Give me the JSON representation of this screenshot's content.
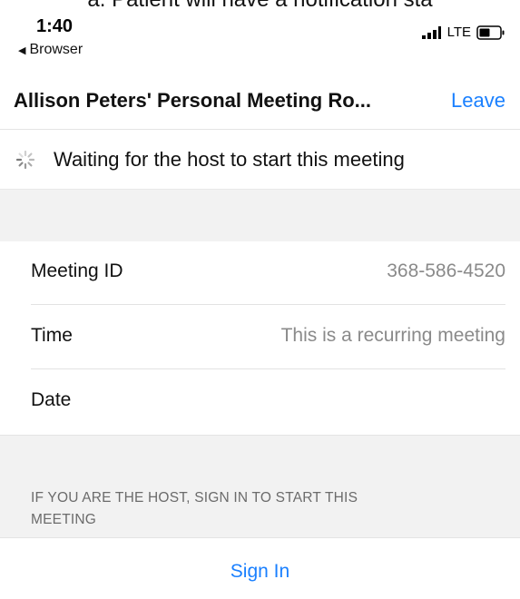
{
  "doc_crop_text": "a. Patient will have a notification sta",
  "status_bar": {
    "time": "1:40",
    "back_app": "Browser",
    "network": "LTE"
  },
  "header": {
    "title": "Allison Peters' Personal Meeting Ro...",
    "leave_label": "Leave"
  },
  "waiting": {
    "text": "Waiting for the host to start this meeting"
  },
  "details": [
    {
      "label": "Meeting ID",
      "value": "368-586-4520"
    },
    {
      "label": "Time",
      "value": "This is a recurring meeting"
    },
    {
      "label": "Date",
      "value": ""
    }
  ],
  "host_note": "IF YOU ARE THE HOST, SIGN IN TO START THIS MEETING",
  "sign_in_label": "Sign In",
  "colors": {
    "accent": "#1a80ff",
    "section_bg": "#f2f2f2",
    "secondary_text": "#8a8a8a"
  },
  "icons": {
    "back": "back-caret-icon",
    "signal": "signal-bars-icon",
    "battery": "battery-icon",
    "spinner": "loading-spinner-icon"
  }
}
